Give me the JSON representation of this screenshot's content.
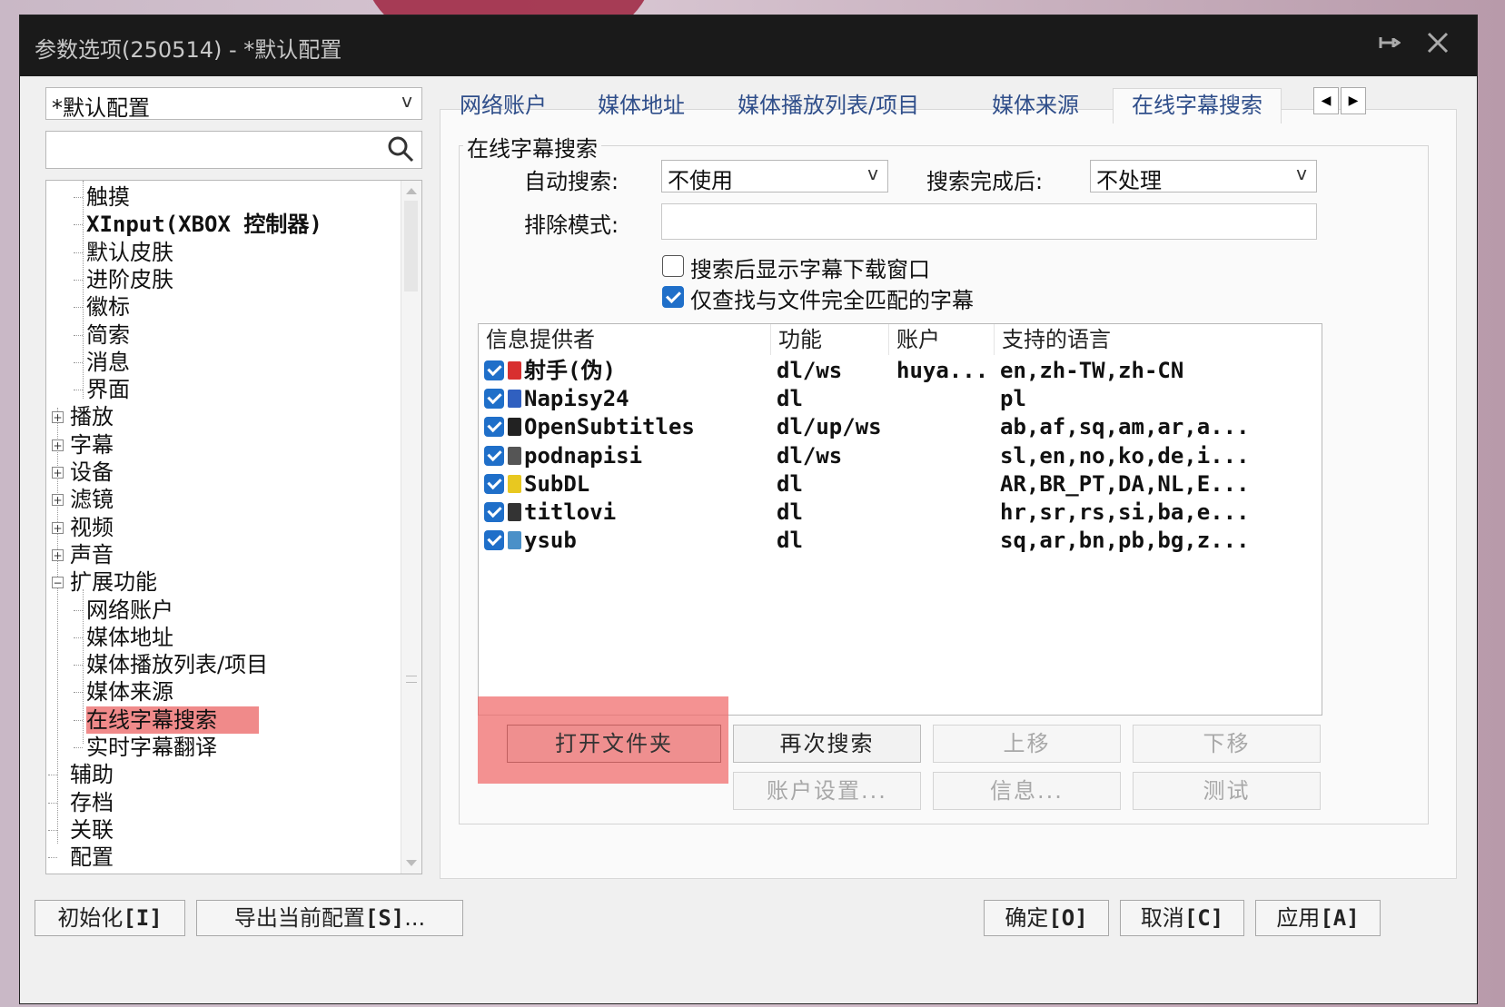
{
  "window": {
    "title": "参数选项(250514) - *默认配置",
    "pin_icon": "pin-icon",
    "close_icon": "close-icon"
  },
  "profile_select": {
    "value": "*默认配置",
    "arrow": "v"
  },
  "search": {
    "value": "",
    "icon": "search-icon"
  },
  "tree": {
    "items": [
      {
        "label": "触摸"
      },
      {
        "label": "XInput(XBOX 控制器)"
      },
      {
        "label": "默认皮肤"
      },
      {
        "label": "进阶皮肤"
      },
      {
        "label": "徽标"
      },
      {
        "label": "简索"
      },
      {
        "label": "消息"
      },
      {
        "label": "界面"
      },
      {
        "label": "播放",
        "expander": "+"
      },
      {
        "label": "字幕",
        "expander": "+"
      },
      {
        "label": "设备",
        "expander": "+"
      },
      {
        "label": "滤镜",
        "expander": "+"
      },
      {
        "label": "视频",
        "expander": "+"
      },
      {
        "label": "声音",
        "expander": "+"
      },
      {
        "label": "扩展功能",
        "expander": "−"
      },
      {
        "label": "网络账户"
      },
      {
        "label": "媒体地址"
      },
      {
        "label": "媒体播放列表/项目"
      },
      {
        "label": "媒体来源"
      },
      {
        "label": "在线字幕搜索",
        "selected": true
      },
      {
        "label": "实时字幕翻译"
      },
      {
        "label": "辅助"
      },
      {
        "label": "存档"
      },
      {
        "label": "关联"
      },
      {
        "label": "配置"
      }
    ]
  },
  "tabs": [
    {
      "label": "网络账户"
    },
    {
      "label": "媒体地址"
    },
    {
      "label": "媒体播放列表/项目"
    },
    {
      "label": "媒体来源"
    },
    {
      "label": "在线字幕搜索",
      "active": true
    }
  ],
  "tab_arrows": {
    "left": "◀",
    "right": "▶"
  },
  "group": {
    "title": "在线字幕搜索",
    "auto_search_label": "自动搜索:",
    "auto_search_value": "不使用",
    "after_search_label": "搜索完成后:",
    "after_search_value": "不处理",
    "exclude_label": "排除模式:",
    "exclude_value": "",
    "show_download_window": {
      "label": "搜索后显示字幕下载窗口",
      "checked": false
    },
    "exact_match_only": {
      "label": "仅查找与文件完全匹配的字幕",
      "checked": true
    },
    "dropdown_arrow": "v"
  },
  "providers": {
    "columns": [
      "信息提供者",
      "功能",
      "账户",
      "支持的语言"
    ],
    "rows": [
      {
        "name": "射手(伪)",
        "func": "dl/ws",
        "account": "huya...",
        "langs": "en,zh-TW,zh-CN",
        "icon": "shooter-icon",
        "icon_color": "#d83030"
      },
      {
        "name": "Napisy24",
        "func": "dl",
        "account": "",
        "langs": "pl",
        "icon": "napisy24-icon",
        "icon_color": "#3060c0"
      },
      {
        "name": "OpenSubtitles",
        "func": "dl/up/ws",
        "account": "",
        "langs": "ab,af,sq,am,ar,a...",
        "icon": "opensubtitles-icon",
        "icon_color": "#222222"
      },
      {
        "name": "podnapisi",
        "func": "dl/ws",
        "account": "",
        "langs": "sl,en,no,ko,de,i...",
        "icon": "podnapisi-icon",
        "icon_color": "#555555"
      },
      {
        "name": "SubDL",
        "func": "dl",
        "account": "",
        "langs": "AR,BR_PT,DA,NL,E...",
        "icon": "subdl-icon",
        "icon_color": "#e8c820"
      },
      {
        "name": "titlovi",
        "func": "dl",
        "account": "",
        "langs": "hr,sr,rs,si,ba,e...",
        "icon": "titlovi-icon",
        "icon_color": "#333333"
      },
      {
        "name": "ysub",
        "func": "dl",
        "account": "",
        "langs": "sq,ar,bn,pb,bg,z...",
        "icon": "ysub-icon",
        "icon_color": "#4a90c8"
      }
    ]
  },
  "buttons": {
    "open_folder": "打开文件夹",
    "search_again": "再次搜索",
    "move_up": "上移",
    "move_down": "下移",
    "account_settings": "账户设置...",
    "info": "信息...",
    "test": "测试"
  },
  "footer": {
    "init": "初始化",
    "init_key": "[I]",
    "export": "导出当前配置",
    "export_key": "[S]",
    "export_suffix": "...",
    "ok": "确定",
    "ok_key": "[O]",
    "cancel": "取消",
    "cancel_key": "[C]",
    "apply": "应用",
    "apply_key": "[A]"
  },
  "colors": {
    "accent": "#1f6fc9",
    "highlight": "#f08a8a",
    "tab_text": "#2f4e8a",
    "titlebar": "#1a1a1a"
  }
}
